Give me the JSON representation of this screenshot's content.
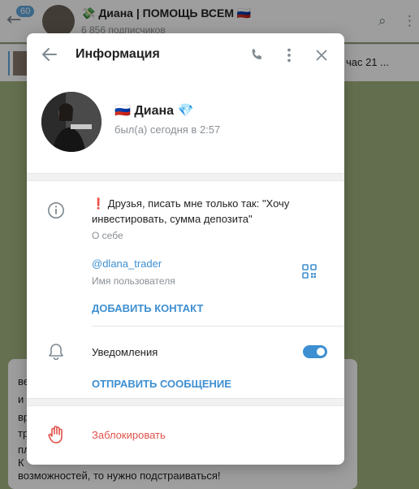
{
  "background": {
    "badge": "60",
    "chat_title": "💸 Диана | ПОМОЩЬ ВСЕМ 🇷🇺",
    "subscribers": "6 856 подписчиков",
    "pinned_text": "час 21 ...",
    "message_lines": [
      "ве",
      "и",
      "вр",
      "тр",
      "пл",
      "К",
      "возможностей, то нужно подстраиваться!"
    ]
  },
  "dialog": {
    "title": "Информация",
    "profile": {
      "name": "🇷🇺 Диана 💎",
      "status": "был(а) сегодня в 2:57"
    },
    "bio": {
      "text": "❗ Друзья, писать мне только так: \"Хочу инвестировать, сумма депозита\"",
      "label": "О себе"
    },
    "username": {
      "value": "@dlana_trader",
      "label": "Имя пользователя"
    },
    "add_contact_label": "ДОБАВИТЬ КОНТАКТ",
    "notifications": {
      "label": "Уведомления",
      "enabled": true
    },
    "send_message_label": "ОТПРАВИТЬ СООБЩЕНИЕ",
    "block_label": "Заблокировать"
  },
  "colors": {
    "accent": "#3d8fd1",
    "danger": "#e0524a",
    "secondary_text": "#8a8f94"
  }
}
